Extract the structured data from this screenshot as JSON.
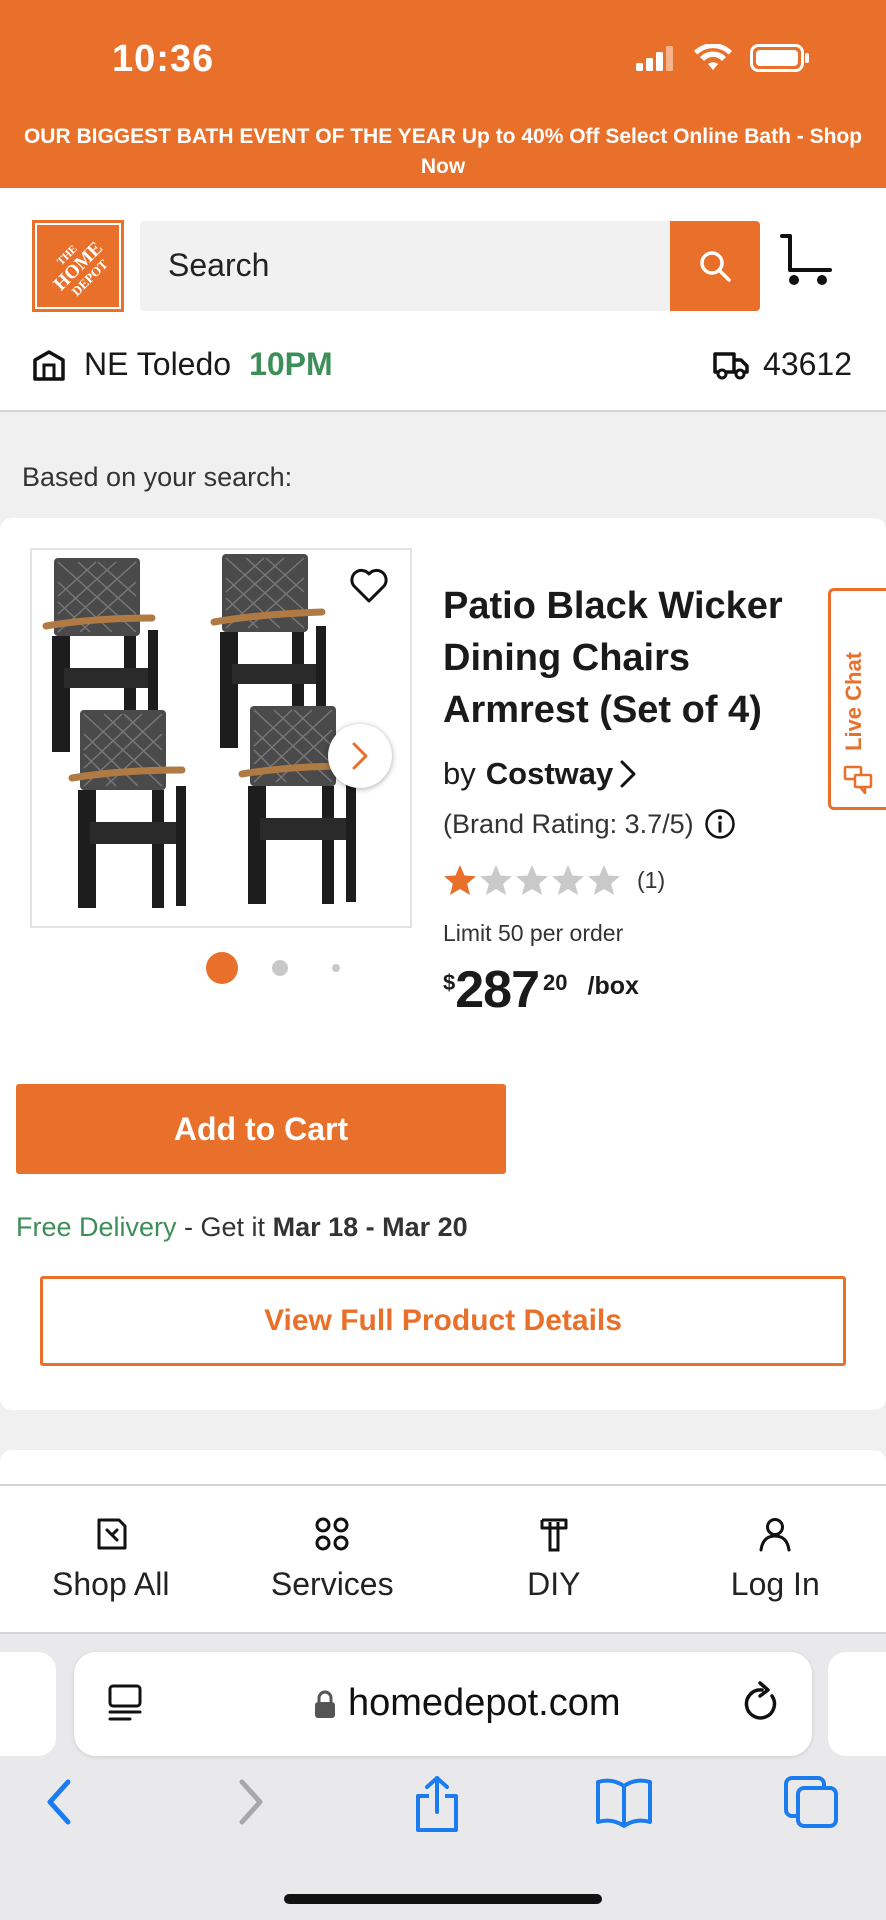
{
  "status_bar": {
    "time": "10:36"
  },
  "promo": {
    "text": "OUR BIGGEST BATH EVENT OF THE YEAR Up to 40% Off Select Online Bath - Shop Now"
  },
  "header": {
    "logo_text": "THE HOME DEPOT",
    "search_placeholder": "Search",
    "store_name": "NE Toledo",
    "store_hours": "10PM",
    "zip": "43612"
  },
  "results": {
    "heading": "Based on your search:",
    "product": {
      "title": "Patio Black Wicker Dining Chairs Armrest (Set of 4)",
      "by": "by",
      "brand": "Costway",
      "brand_rating": "(Brand Rating: 3.7/5)",
      "rating_value": 1,
      "rating_max": 5,
      "rating_count": "(1)",
      "limit": "Limit 50 per order",
      "price_currency": "$",
      "price_dollars": "287",
      "price_cents": "20",
      "price_unit": "/box",
      "image_pages": 3,
      "image_current": 1,
      "add_to_cart": "Add to Cart",
      "delivery_free": "Free Delivery",
      "delivery_mid": " - Get it ",
      "delivery_dates": "Mar 18 - Mar 20",
      "view_details": "View Full Product Details"
    },
    "live_chat": "Live Chat"
  },
  "bottom_nav": {
    "items": [
      {
        "label": "Shop All",
        "icon": "shop-all-icon"
      },
      {
        "label": "Services",
        "icon": "services-icon"
      },
      {
        "label": "DIY",
        "icon": "diy-icon"
      },
      {
        "label": "Log In",
        "icon": "user-icon"
      }
    ]
  },
  "browser": {
    "url": "homedepot.com"
  },
  "colors": {
    "brand_orange": "#e8702a",
    "green": "#3e8e5a",
    "ios_blue": "#1a7cf0"
  }
}
